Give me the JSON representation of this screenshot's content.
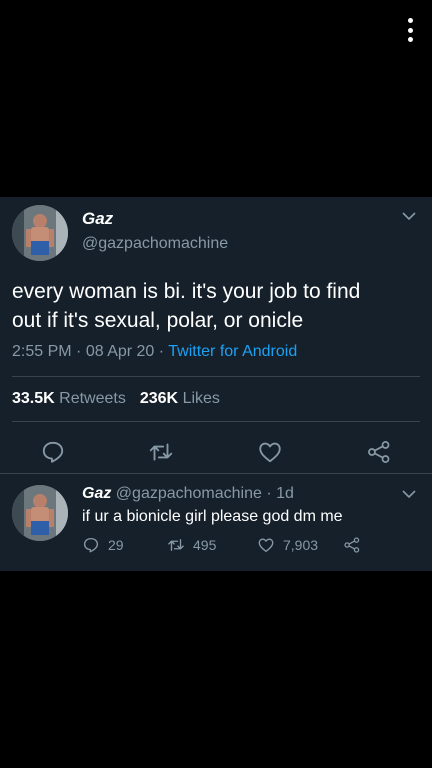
{
  "icons": {
    "overflow": "more-vertical-icon",
    "reply": "reply-bubble-icon",
    "retweet": "retweet-icon",
    "like": "heart-icon",
    "share": "share-icon",
    "chevron": "chevron-down-icon"
  },
  "colors": {
    "card_bg": "#15202b",
    "secondary_text": "#8899a6",
    "link_blue": "#1da1f2",
    "divider": "#38444d"
  },
  "tweet": {
    "author_name": "Gaz",
    "author_handle": "@gazpachomachine",
    "text_line1": "every woman is bi. it's your job to find",
    "text_line2": "out if it's sexual, polar, or onicle",
    "time": "2:55 PM",
    "date": "08 Apr 20",
    "separator": "·",
    "source": "Twitter for Android",
    "retweets_count": "33.5K",
    "retweets_label": "Retweets",
    "likes_count": "236K",
    "likes_label": "Likes"
  },
  "reply": {
    "author_name": "Gaz",
    "author_handle": "@gazpachomachine",
    "separator": "·",
    "age": "1d",
    "text": "if ur a bionicle girl please god dm me",
    "reply_count": "29",
    "retweet_count": "495",
    "like_count": "7,903"
  }
}
